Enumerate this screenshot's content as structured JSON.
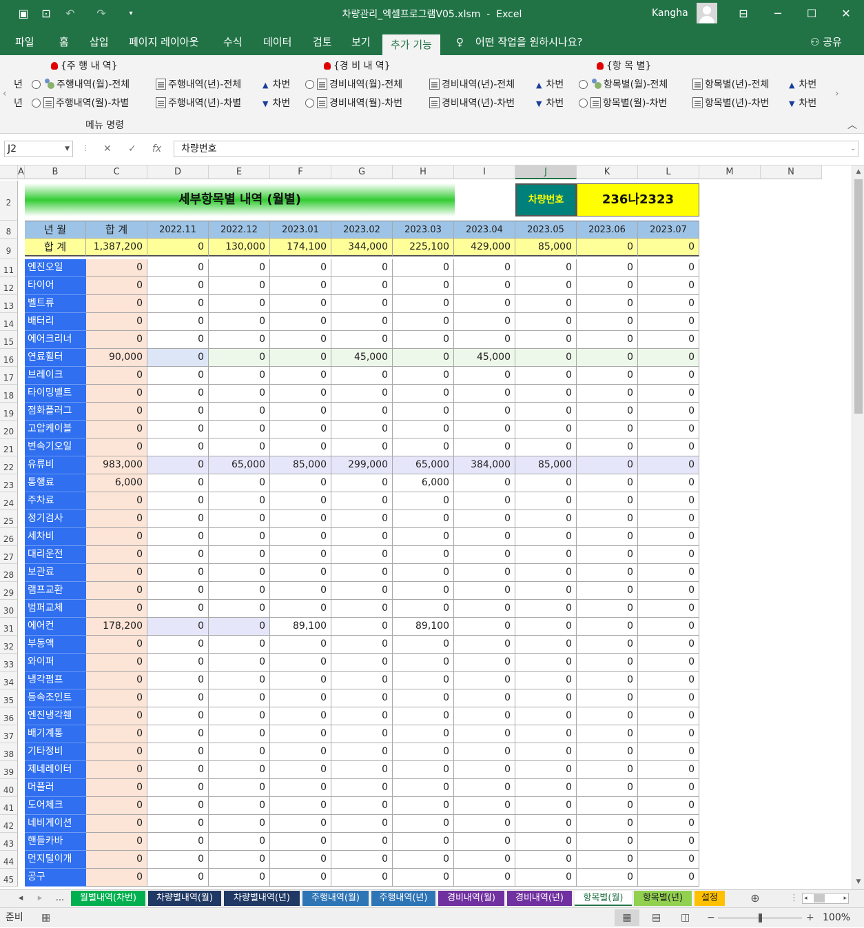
{
  "title_bar": {
    "filename": "차량관리_엑셀프로그램V05.xlsm",
    "sep": "-",
    "app": "Excel",
    "user": "Kangha"
  },
  "ribbon_tabs": [
    "파일",
    "홈",
    "삽입",
    "페이지 레이아웃",
    "수식",
    "데이터",
    "검토",
    "보기",
    "추가 기능"
  ],
  "tell_me": "어떤 작업을 원하시나요?",
  "share": "공유",
  "ribbon": {
    "left_cut": [
      "년",
      "년"
    ],
    "groups": [
      {
        "header": "{주 행 내 역}",
        "row1": {
          "a": "주행내역(월)-전체",
          "b": "주행내역(년)-전체",
          "c": "차번"
        },
        "row2": {
          "a": "주행내역(월)-차별",
          "b": "주행내역(년)-차별",
          "c": "차번"
        }
      },
      {
        "header": "{경 비 내 역}",
        "row1": {
          "a": "경비내역(월)-전체",
          "b": "경비내역(년)-전체",
          "c": "차번"
        },
        "row2": {
          "a": "경비내역(월)-차번",
          "b": "경비내역(년)-차번",
          "c": "차번"
        }
      },
      {
        "header": "{항 목 별}",
        "row1": {
          "a": "항목별(월)-전체",
          "b": "항목별(년)-전체",
          "c": "차번"
        },
        "row2": {
          "a": "항목별(월)-차번",
          "b": "항목별(년)-차번",
          "c": "차번"
        }
      }
    ],
    "footer": "메뉴 명령"
  },
  "formula_bar": {
    "namebox": "J2",
    "fx": "fx",
    "content": "차량번호"
  },
  "columns": [
    "A",
    "B",
    "C",
    "D",
    "E",
    "F",
    "G",
    "H",
    "I",
    "J",
    "K",
    "L",
    "M",
    "N"
  ],
  "sheet": {
    "title": "세부항목별 내역 (월별)",
    "vehicle_label": "차량번호",
    "vehicle_value": "236나2323",
    "header": [
      "년  월",
      "합  계",
      "2022.11",
      "2022.12",
      "2023.01",
      "2023.02",
      "2023.03",
      "2023.04",
      "2023.05",
      "2023.06",
      "2023.07"
    ],
    "total": [
      "합 계",
      "1,387,200",
      "0",
      "130,000",
      "174,100",
      "344,000",
      "225,100",
      "429,000",
      "85,000",
      "0",
      "0"
    ],
    "rows": [
      {
        "n": "11",
        "name": "엔진오일",
        "v": [
          "0",
          "0",
          "0",
          "0",
          "0",
          "0",
          "0",
          "0",
          "0",
          "0"
        ]
      },
      {
        "n": "12",
        "name": "타이어",
        "v": [
          "0",
          "0",
          "0",
          "0",
          "0",
          "0",
          "0",
          "0",
          "0",
          "0"
        ]
      },
      {
        "n": "13",
        "name": "벨트류",
        "v": [
          "0",
          "0",
          "0",
          "0",
          "0",
          "0",
          "0",
          "0",
          "0",
          "0"
        ]
      },
      {
        "n": "14",
        "name": "배터리",
        "v": [
          "0",
          "0",
          "0",
          "0",
          "0",
          "0",
          "0",
          "0",
          "0",
          "0"
        ]
      },
      {
        "n": "15",
        "name": "에어크리너",
        "v": [
          "0",
          "0",
          "0",
          "0",
          "0",
          "0",
          "0",
          "0",
          "0",
          "0"
        ]
      },
      {
        "n": "16",
        "name": "연료휠터",
        "v": [
          "90,000",
          "0",
          "0",
          "0",
          "45,000",
          "0",
          "45,000",
          "0",
          "0",
          "0"
        ]
      },
      {
        "n": "17",
        "name": "브레이크",
        "v": [
          "0",
          "0",
          "0",
          "0",
          "0",
          "0",
          "0",
          "0",
          "0",
          "0"
        ]
      },
      {
        "n": "18",
        "name": "타이밍벨트",
        "v": [
          "0",
          "0",
          "0",
          "0",
          "0",
          "0",
          "0",
          "0",
          "0",
          "0"
        ]
      },
      {
        "n": "19",
        "name": "점화플러그",
        "v": [
          "0",
          "0",
          "0",
          "0",
          "0",
          "0",
          "0",
          "0",
          "0",
          "0"
        ]
      },
      {
        "n": "20",
        "name": "고압케이블",
        "v": [
          "0",
          "0",
          "0",
          "0",
          "0",
          "0",
          "0",
          "0",
          "0",
          "0"
        ]
      },
      {
        "n": "21",
        "name": "변속기오일",
        "v": [
          "0",
          "0",
          "0",
          "0",
          "0",
          "0",
          "0",
          "0",
          "0",
          "0"
        ]
      },
      {
        "n": "22",
        "name": "유류비",
        "v": [
          "983,000",
          "0",
          "65,000",
          "85,000",
          "299,000",
          "65,000",
          "384,000",
          "85,000",
          "0",
          "0"
        ]
      },
      {
        "n": "23",
        "name": "통행료",
        "v": [
          "6,000",
          "0",
          "0",
          "0",
          "0",
          "6,000",
          "0",
          "0",
          "0",
          "0"
        ]
      },
      {
        "n": "24",
        "name": "주차료",
        "v": [
          "0",
          "0",
          "0",
          "0",
          "0",
          "0",
          "0",
          "0",
          "0",
          "0"
        ]
      },
      {
        "n": "25",
        "name": "정기검사",
        "v": [
          "0",
          "0",
          "0",
          "0",
          "0",
          "0",
          "0",
          "0",
          "0",
          "0"
        ]
      },
      {
        "n": "26",
        "name": "세차비",
        "v": [
          "0",
          "0",
          "0",
          "0",
          "0",
          "0",
          "0",
          "0",
          "0",
          "0"
        ]
      },
      {
        "n": "27",
        "name": "대리운전",
        "v": [
          "0",
          "0",
          "0",
          "0",
          "0",
          "0",
          "0",
          "0",
          "0",
          "0"
        ]
      },
      {
        "n": "28",
        "name": "보관료",
        "v": [
          "0",
          "0",
          "0",
          "0",
          "0",
          "0",
          "0",
          "0",
          "0",
          "0"
        ]
      },
      {
        "n": "29",
        "name": "램프교환",
        "v": [
          "0",
          "0",
          "0",
          "0",
          "0",
          "0",
          "0",
          "0",
          "0",
          "0"
        ]
      },
      {
        "n": "30",
        "name": "범퍼교체",
        "v": [
          "0",
          "0",
          "0",
          "0",
          "0",
          "0",
          "0",
          "0",
          "0",
          "0"
        ]
      },
      {
        "n": "31",
        "name": "에어컨",
        "v": [
          "178,200",
          "0",
          "0",
          "89,100",
          "0",
          "89,100",
          "0",
          "0",
          "0",
          "0"
        ]
      },
      {
        "n": "32",
        "name": "부동액",
        "v": [
          "0",
          "0",
          "0",
          "0",
          "0",
          "0",
          "0",
          "0",
          "0",
          "0"
        ]
      },
      {
        "n": "33",
        "name": "와이퍼",
        "v": [
          "0",
          "0",
          "0",
          "0",
          "0",
          "0",
          "0",
          "0",
          "0",
          "0"
        ]
      },
      {
        "n": "34",
        "name": "냉각펌프",
        "v": [
          "0",
          "0",
          "0",
          "0",
          "0",
          "0",
          "0",
          "0",
          "0",
          "0"
        ]
      },
      {
        "n": "35",
        "name": "등속조인트",
        "v": [
          "0",
          "0",
          "0",
          "0",
          "0",
          "0",
          "0",
          "0",
          "0",
          "0"
        ]
      },
      {
        "n": "36",
        "name": "엔진냉각휀",
        "v": [
          "0",
          "0",
          "0",
          "0",
          "0",
          "0",
          "0",
          "0",
          "0",
          "0"
        ]
      },
      {
        "n": "37",
        "name": "배기계통",
        "v": [
          "0",
          "0",
          "0",
          "0",
          "0",
          "0",
          "0",
          "0",
          "0",
          "0"
        ]
      },
      {
        "n": "38",
        "name": "기타정비",
        "v": [
          "0",
          "0",
          "0",
          "0",
          "0",
          "0",
          "0",
          "0",
          "0",
          "0"
        ]
      },
      {
        "n": "39",
        "name": "제네레이터",
        "v": [
          "0",
          "0",
          "0",
          "0",
          "0",
          "0",
          "0",
          "0",
          "0",
          "0"
        ]
      },
      {
        "n": "40",
        "name": "머플러",
        "v": [
          "0",
          "0",
          "0",
          "0",
          "0",
          "0",
          "0",
          "0",
          "0",
          "0"
        ]
      },
      {
        "n": "41",
        "name": "도어체크",
        "v": [
          "0",
          "0",
          "0",
          "0",
          "0",
          "0",
          "0",
          "0",
          "0",
          "0"
        ]
      },
      {
        "n": "42",
        "name": "네비게이션",
        "v": [
          "0",
          "0",
          "0",
          "0",
          "0",
          "0",
          "0",
          "0",
          "0",
          "0"
        ]
      },
      {
        "n": "43",
        "name": "핸들카바",
        "v": [
          "0",
          "0",
          "0",
          "0",
          "0",
          "0",
          "0",
          "0",
          "0",
          "0"
        ]
      },
      {
        "n": "44",
        "name": "먼지털이개",
        "v": [
          "0",
          "0",
          "0",
          "0",
          "0",
          "0",
          "0",
          "0",
          "0",
          "0"
        ]
      },
      {
        "n": "45",
        "name": "공구",
        "v": [
          "0",
          "0",
          "0",
          "0",
          "0",
          "0",
          "0",
          "0",
          "0",
          "0"
        ]
      }
    ]
  },
  "sheet_tabs": [
    {
      "label": "월별내역(차번)",
      "bg": "#00b050",
      "fg": "#ffffff"
    },
    {
      "label": "차량별내역(월)",
      "bg": "#1f3864",
      "fg": "#ffffff"
    },
    {
      "label": "차량별내역(년)",
      "bg": "#1f3864",
      "fg": "#ffffff"
    },
    {
      "label": "주행내역(월)",
      "bg": "#2e75b6",
      "fg": "#ffffff"
    },
    {
      "label": "주행내역(년)",
      "bg": "#2e75b6",
      "fg": "#ffffff"
    },
    {
      "label": "경비내역(월)",
      "bg": "#7030a0",
      "fg": "#ffffff"
    },
    {
      "label": "경비내역(년)",
      "bg": "#7030a0",
      "fg": "#ffffff"
    },
    {
      "label": "항목별(월)",
      "bg": "#ffffff",
      "fg": "#217346"
    },
    {
      "label": "항목별(년)",
      "bg": "#92d050",
      "fg": "#222222"
    },
    {
      "label": "설정",
      "bg": "#ffc000",
      "fg": "#222222"
    }
  ],
  "tabs_ellipsis": "...",
  "status": {
    "ready": "준비",
    "zoom": "100%"
  }
}
